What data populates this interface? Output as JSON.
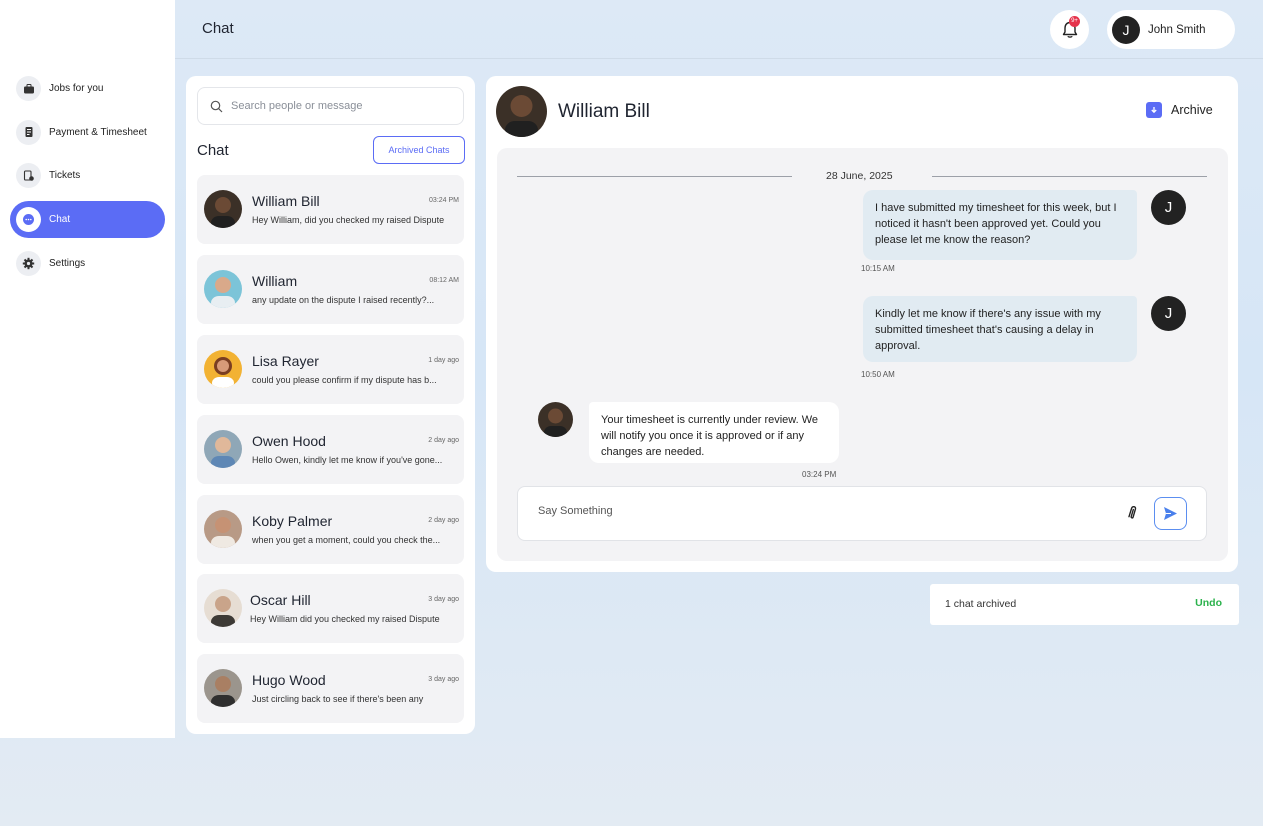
{
  "sidebar": {
    "items": [
      {
        "label": "Jobs for you",
        "icon": "briefcase-icon"
      },
      {
        "label": "Payment & Timesheet",
        "icon": "timesheet-icon"
      },
      {
        "label": "Tickets",
        "icon": "ticket-icon"
      },
      {
        "label": "Chat",
        "icon": "chat-bubble-icon",
        "active": true
      },
      {
        "label": "Settings",
        "icon": "gear-icon"
      }
    ]
  },
  "header": {
    "title": "Chat",
    "notification_badge": "9+",
    "user": {
      "initial": "J",
      "name": "John Smith"
    }
  },
  "chat_list": {
    "search_placeholder": "Search people or message",
    "heading": "Chat",
    "archived_button": "Archived Chats",
    "items": [
      {
        "name": "William Bill",
        "time": "03:24 PM",
        "preview": "Hey William, did you checked my raised Dispute",
        "avatar_color": "#3b3027"
      },
      {
        "name": "William",
        "time": "08:12 AM",
        "preview": "any update on the dispute I raised recently?...",
        "avatar_color": "#7cc4d8"
      },
      {
        "name": "Lisa Rayer",
        "time": "1 day ago",
        "preview": "could you please confirm if my dispute has b...",
        "avatar_color": "#f2b233"
      },
      {
        "name": "Owen Hood",
        "time": "2 day ago",
        "preview": "Hello Owen, kindly let me know if you've gone...",
        "avatar_color": "#8fa7b7"
      },
      {
        "name": "Koby Palmer",
        "time": "2 day ago",
        "preview": "when you get a moment, could you check the...",
        "avatar_color": "#b89a86"
      },
      {
        "name": "Oscar Hill",
        "time": "3 day ago",
        "preview": "Hey William did you checked my raised Dispute",
        "avatar_color": "#c9b9a8"
      },
      {
        "name": "Hugo Wood",
        "time": "3 day ago",
        "preview": "Just circling back to see if there's been any",
        "avatar_color": "#6c6a66"
      }
    ]
  },
  "conversation": {
    "name": "William Bill",
    "archive_label": "Archive",
    "date": "28 June, 2025",
    "messages": [
      {
        "from": "me",
        "text": "I have submitted my timesheet for this week, but I noticed it hasn't been approved yet. Could you please let me know the reason?",
        "time": "10:15 AM"
      },
      {
        "from": "me",
        "text": "Kindly let me know if there's any issue with my submitted timesheet that's causing a delay in approval.",
        "time": "10:50 AM"
      },
      {
        "from": "them",
        "text": "Your timesheet is currently under review. We will notify you once it is approved or if any changes are needed.",
        "time": "03:24 PM"
      }
    ],
    "composer_placeholder": "Say Something"
  },
  "toast": {
    "text": "1 chat archived",
    "action": "Undo"
  },
  "colors": {
    "accent": "#5b6cf5",
    "undo": "#2bb24c",
    "badge": "#e5334b"
  }
}
